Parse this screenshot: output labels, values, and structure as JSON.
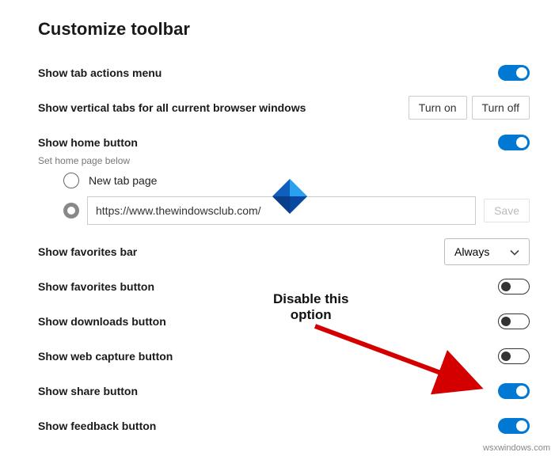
{
  "title": "Customize toolbar",
  "rows": {
    "tab_actions": {
      "label": "Show tab actions menu",
      "on": true
    },
    "vertical_tabs": {
      "label": "Show vertical tabs for all current browser windows",
      "turn_on": "Turn on",
      "turn_off": "Turn off"
    },
    "home_button": {
      "label": "Show home button",
      "on": true,
      "sub": "Set home page below"
    },
    "radio_new_tab": "New tab page",
    "url_value": "https://www.thewindowsclub.com/",
    "save": "Save",
    "favorites_bar": {
      "label": "Show favorites bar",
      "dropdown": "Always"
    },
    "favorites_button": {
      "label": "Show favorites button",
      "on": false
    },
    "downloads": {
      "label": "Show downloads button",
      "on": false
    },
    "web_capture": {
      "label": "Show web capture button",
      "on": false
    },
    "share": {
      "label": "Show share button",
      "on": true
    },
    "feedback": {
      "label": "Show feedback button",
      "on": true
    }
  },
  "annotation": {
    "line1": "Disable this",
    "line2": "option"
  },
  "watermark": "wsxwindows.com"
}
